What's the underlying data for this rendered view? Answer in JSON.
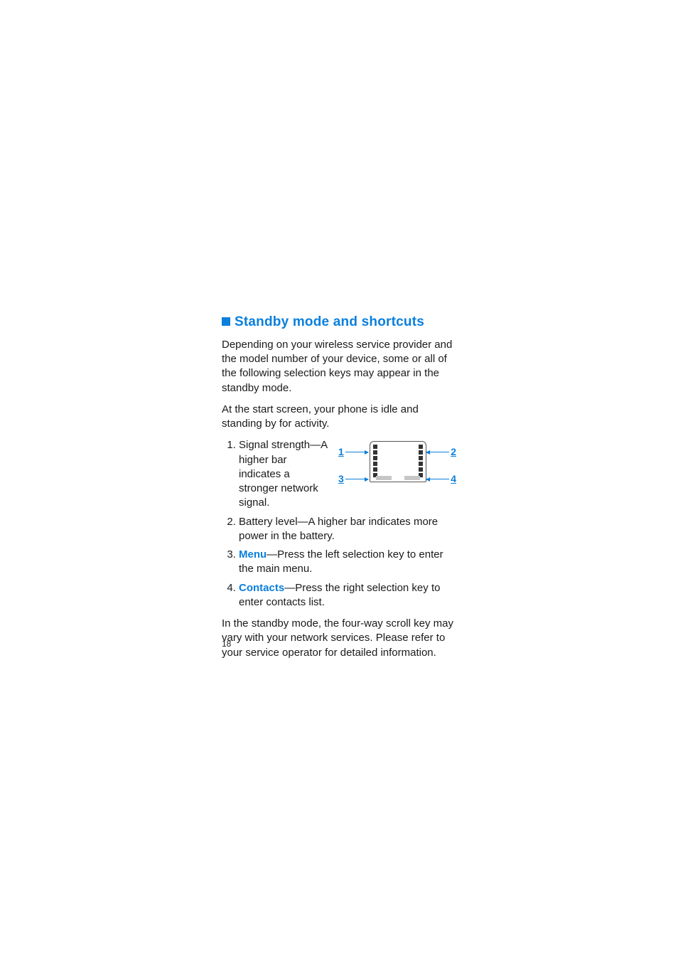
{
  "heading": "Standby mode and shortcuts",
  "intro_p1": "Depending on your wireless service provider and the model number of your device, some or all of the following selection keys may appear in the standby mode.",
  "intro_p2": "At the start screen, your phone is idle and standing by for activity.",
  "list": {
    "item1": "Signal strength—A higher bar indicates a stronger network signal.",
    "item2": "Battery level—A higher bar indicates more power in the battery.",
    "item3_link": "Menu",
    "item3_rest": "—Press the left selection key to enter the main menu.",
    "item4_link": "Contacts",
    "item4_rest": "—Press the right selection key to enter contacts list."
  },
  "outro": "In the standby mode, the four-way scroll key may vary with your network services. Please refer to your service operator for detailed information.",
  "diagram": {
    "label1": "1",
    "label2": "2",
    "label3": "3",
    "label4": "4"
  },
  "page_number": "18"
}
